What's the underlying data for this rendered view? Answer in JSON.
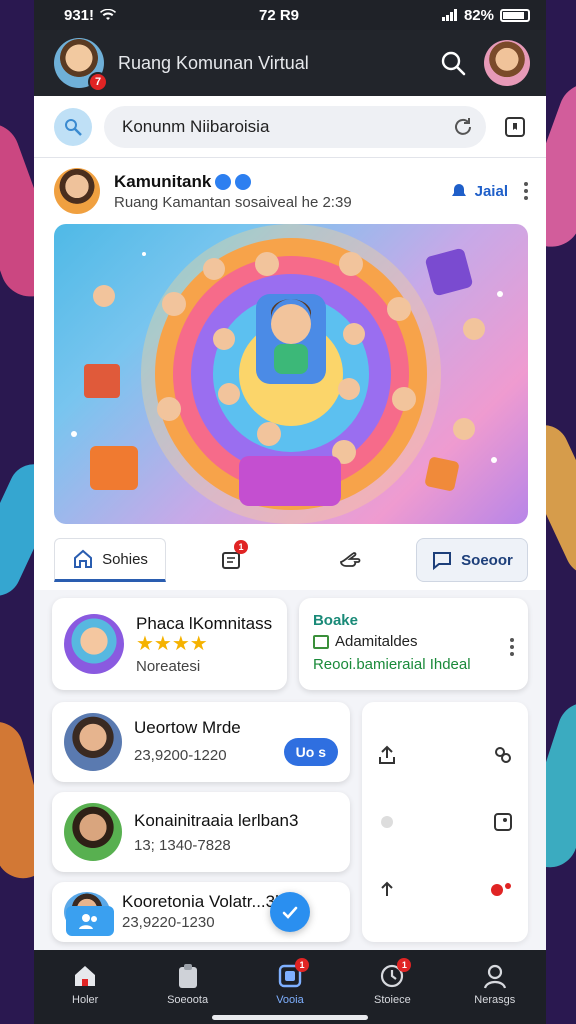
{
  "status_bar": {
    "left": "931!",
    "time": "72 R9",
    "battery": "82%"
  },
  "header": {
    "title": "Ruang Komunan Virtual",
    "notification_count": "7"
  },
  "search": {
    "value": "Konunm Niibaroisia"
  },
  "post": {
    "author": "Kamunitank",
    "subtitle": "Ruang Kamantan sosaiveal he 2:39",
    "follow_label": "Jaial"
  },
  "actions": {
    "home_label": "Sohies",
    "doc_badge": "1",
    "share_label": "Soeoor"
  },
  "cards": [
    {
      "title": "Phaca lKomnitass",
      "rating": "★★★★",
      "sub": "Noreatesi"
    },
    {
      "title": "Boake",
      "line1": "Adamitaldes",
      "line2": "Reooi.bamieraial Ihdeal"
    }
  ],
  "list": [
    {
      "title": "Ueortow Mrde",
      "sub": "23,9200-1220",
      "action": "Uo s"
    },
    {
      "title": "Konainitraaia lerlban3",
      "sub": "13; 1340-7828"
    },
    {
      "title": "Kooretonia Volatr...3l",
      "sub": "23,9220-1230"
    }
  ],
  "bottom_nav": [
    {
      "label": "Holer"
    },
    {
      "label": "Soeoota"
    },
    {
      "label": "Vooia",
      "badge": "1"
    },
    {
      "label": "Stoiece",
      "badge": "1"
    },
    {
      "label": "Nerasgs"
    }
  ],
  "colors": {
    "accent": "#2f6fe0",
    "header_bg": "#22252b",
    "badge": "#e02424"
  }
}
